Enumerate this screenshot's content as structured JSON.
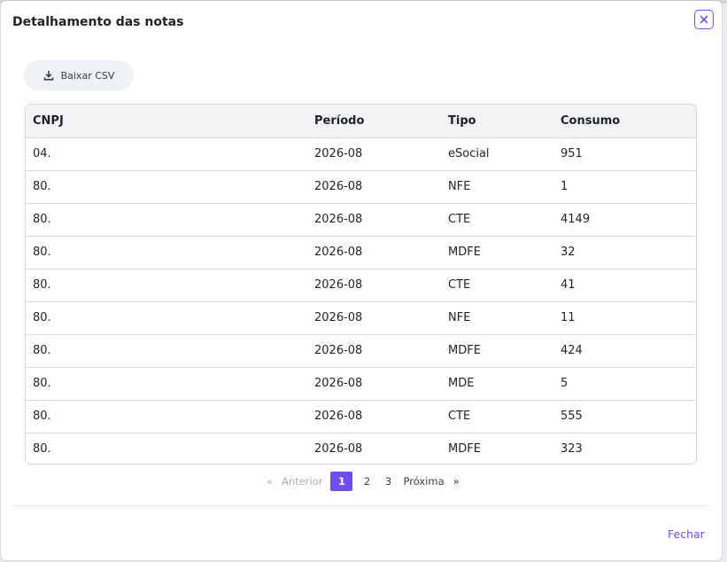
{
  "modal": {
    "title": "Detalhamento das notas",
    "close_label": "Fechar"
  },
  "toolbar": {
    "csv_label": "Baixar CSV"
  },
  "table": {
    "headers": [
      "CNPJ",
      "Período",
      "Tipo",
      "Consumo"
    ],
    "rows": [
      {
        "cnpj": "04.",
        "periodo": "2026-08",
        "tipo": "eSocial",
        "consumo": "951"
      },
      {
        "cnpj": "80.",
        "periodo": "2026-08",
        "tipo": "NFE",
        "consumo": "1"
      },
      {
        "cnpj": "80.",
        "periodo": "2026-08",
        "tipo": "CTE",
        "consumo": "4149"
      },
      {
        "cnpj": "80.",
        "periodo": "2026-08",
        "tipo": "MDFE",
        "consumo": "32"
      },
      {
        "cnpj": "80.",
        "periodo": "2026-08",
        "tipo": "CTE",
        "consumo": "41"
      },
      {
        "cnpj": "80.",
        "periodo": "2026-08",
        "tipo": "NFE",
        "consumo": "11"
      },
      {
        "cnpj": "80.",
        "periodo": "2026-08",
        "tipo": "MDFE",
        "consumo": "424"
      },
      {
        "cnpj": "80.",
        "periodo": "2026-08",
        "tipo": "MDE",
        "consumo": "5"
      },
      {
        "cnpj": "80.",
        "periodo": "2026-08",
        "tipo": "CTE",
        "consumo": "555"
      },
      {
        "cnpj": "80.",
        "periodo": "2026-08",
        "tipo": "MDFE",
        "consumo": "323"
      }
    ]
  },
  "pagination": {
    "first_symbol": "«",
    "prev_label": "Anterior",
    "pages": [
      "1",
      "2",
      "3"
    ],
    "current_page": "1",
    "next_label": "Próxima",
    "last_symbol": "»"
  },
  "colors": {
    "accent": "#6f4df5",
    "header_bg": "#f1f3f5",
    "border": "#d5d8dc"
  },
  "icons": {
    "close": "close-icon",
    "download": "download-icon"
  }
}
